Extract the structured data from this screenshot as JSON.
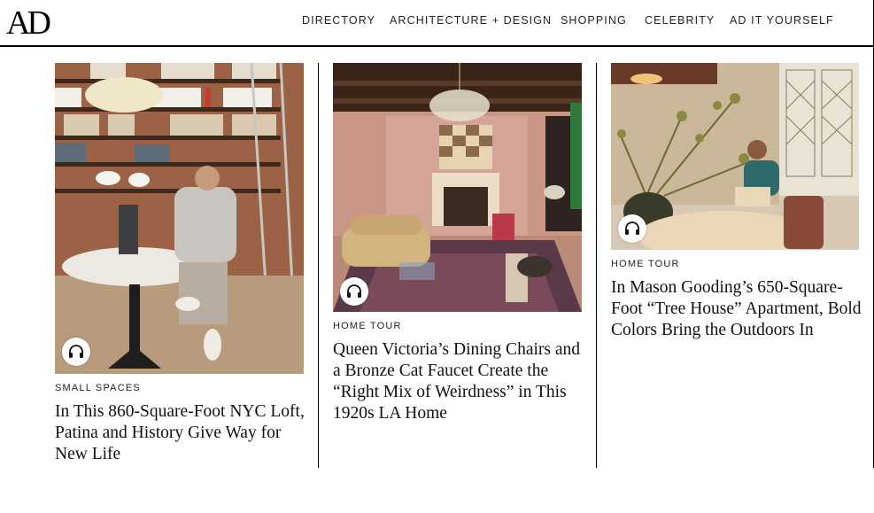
{
  "header": {
    "logo": "AD",
    "nav": [
      "DIRECTORY",
      "ARCHITECTURE + DESIGN",
      "SHOPPING",
      "CELEBRITY",
      "AD IT YOURSELF"
    ]
  },
  "cards": [
    {
      "kicker": "SMALL SPACES",
      "headline": "In This 860-Square-Foot NYC Loft, Patina and History Give Way for New Life",
      "audio_icon": "headphones-icon"
    },
    {
      "kicker": "HOME TOUR",
      "headline": "Queen Victoria’s Dining Chairs and a Bronze Cat Faucet Create the “Right Mix of Weirdness” in This 1920s LA Home",
      "audio_icon": "headphones-icon"
    },
    {
      "kicker": "HOME TOUR",
      "headline": "In Mason Gooding’s 650-Square-Foot “Tree House” Apartment, Bold Colors Bring the Outdoors In",
      "audio_icon": "headphones-icon"
    }
  ]
}
